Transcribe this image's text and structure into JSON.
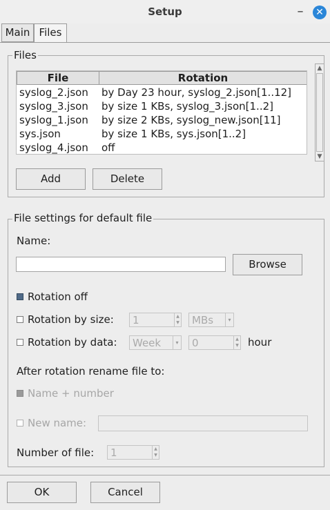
{
  "window": {
    "title": "Setup",
    "minimize_glyph": "–",
    "close_glyph": "✕"
  },
  "tabs": [
    {
      "label": "Main"
    },
    {
      "label": "Files"
    }
  ],
  "files_group": {
    "legend": "Files",
    "columns": {
      "file": "File",
      "rotation": "Rotation"
    },
    "rows": [
      {
        "file": "syslog_2.json",
        "rotation": "by Day 23 hour, syslog_2.json[1..12]"
      },
      {
        "file": "syslog_3.json",
        "rotation": "by size 1 KBs, syslog_3.json[1..2]"
      },
      {
        "file": "syslog_1.json",
        "rotation": "by size 2 KBs, syslog_new.json[11]"
      },
      {
        "file": "sys.json",
        "rotation": "by size 1 KBs, sys.json[1..2]"
      },
      {
        "file": "syslog_4.json",
        "rotation": "off"
      }
    ],
    "add_label": "Add",
    "delete_label": "Delete"
  },
  "settings_group": {
    "legend": "File settings for default file",
    "name_label": "Name:",
    "name_value": "",
    "browse_label": "Browse",
    "rotation_off_label": "Rotation off",
    "rotation_size_label": "Rotation by size:",
    "size_value": "1",
    "size_unit": "MBs",
    "rotation_data_label": "Rotation by data:",
    "data_period": "Week",
    "data_hour_value": "0",
    "hour_label": "hour",
    "after_rotation_label": "After rotation rename file to:",
    "name_number_label": "Name + number",
    "new_name_label": "New name:",
    "new_name_value": "",
    "number_of_file_label": "Number of file:",
    "number_of_file_value": "1"
  },
  "footer": {
    "ok_label": "OK",
    "cancel_label": "Cancel"
  }
}
